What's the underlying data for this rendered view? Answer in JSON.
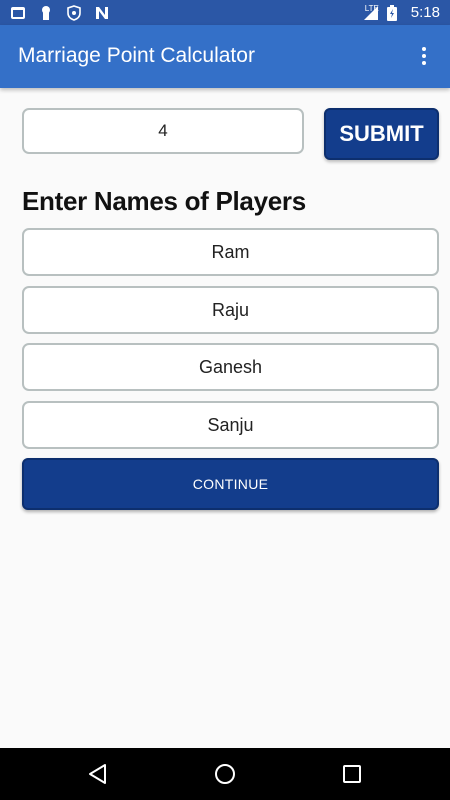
{
  "status_bar": {
    "time": "5:18",
    "network": "LTE",
    "icons": [
      "app-notification-icon",
      "keyhole-icon",
      "shield-icon",
      "n-notification-icon",
      "signal-icon",
      "battery-charging-icon"
    ]
  },
  "app_bar": {
    "title": "Marriage Point Calculator",
    "menu_icon": "more-vertical-icon"
  },
  "player_count": {
    "value": "4",
    "submit_label": "SUBMIT"
  },
  "section": {
    "title": "Enter Names of Players"
  },
  "players": [
    "Ram",
    "Raju",
    "Ganesh",
    "Sanju"
  ],
  "continue_label": "CONTINUE",
  "colors": {
    "status_bar": "#2b57a6",
    "app_bar": "#3470c8",
    "button": "#133d8c",
    "background": "#fafafa"
  },
  "nav_bar": {
    "icons": [
      "back-icon",
      "home-icon",
      "recents-icon"
    ]
  }
}
